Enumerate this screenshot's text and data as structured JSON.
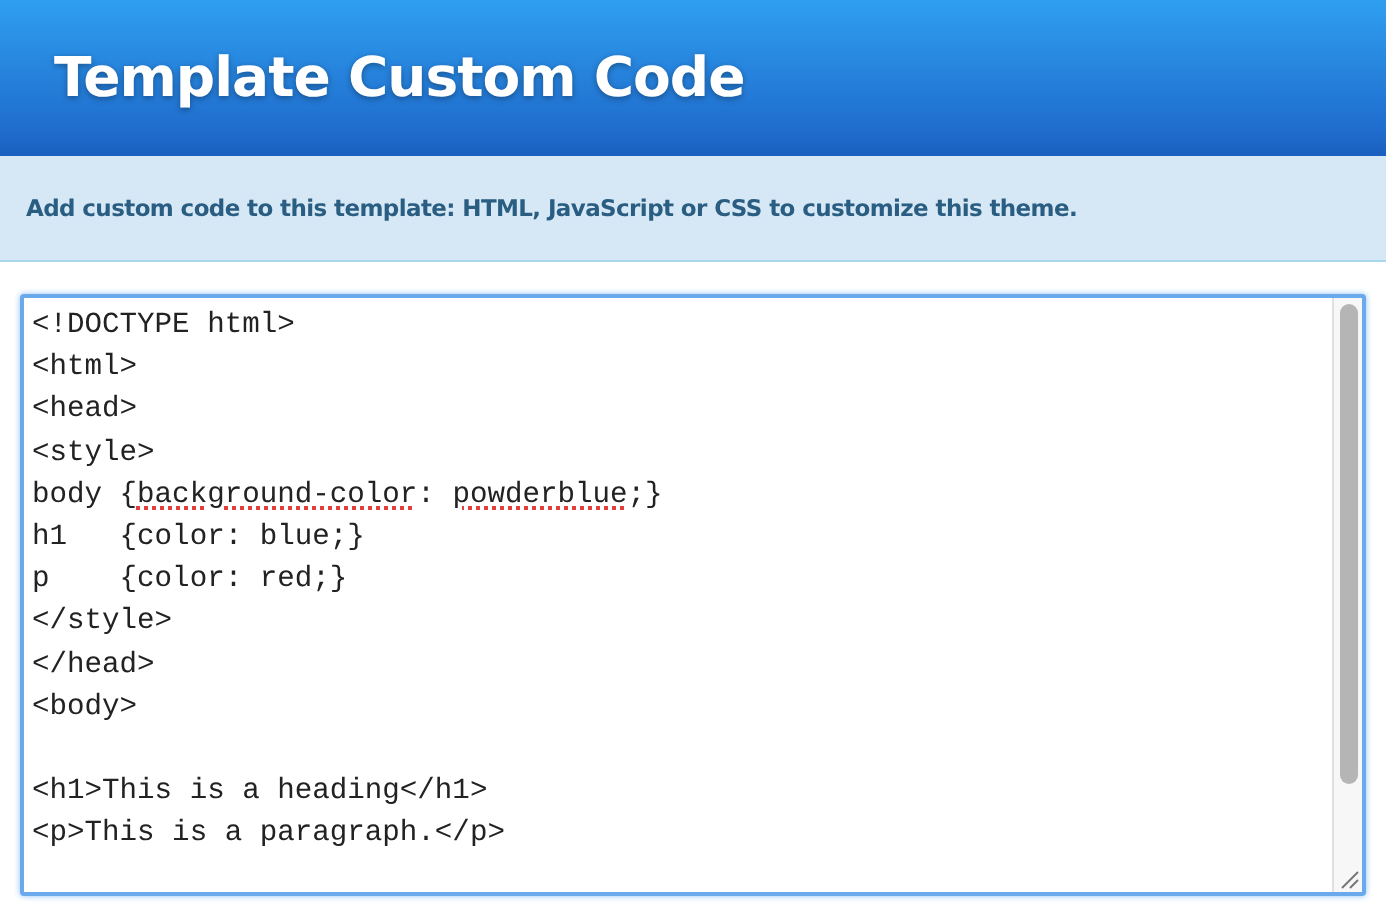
{
  "header": {
    "title": "Template Custom Code"
  },
  "info_bar": {
    "text": "Add custom code to this template: HTML, JavaScript or CSS to customize this theme."
  },
  "editor": {
    "focused": true,
    "lines": [
      {
        "kind": "code",
        "segments": [
          {
            "text": "<!DOCTYPE html>",
            "misspelled": false
          }
        ]
      },
      {
        "kind": "code",
        "segments": [
          {
            "text": "<html>",
            "misspelled": false
          }
        ]
      },
      {
        "kind": "code",
        "segments": [
          {
            "text": "<head>",
            "misspelled": false
          }
        ]
      },
      {
        "kind": "code",
        "segments": [
          {
            "text": "<style>",
            "misspelled": false
          }
        ]
      },
      {
        "kind": "code",
        "segments": [
          {
            "text": "body {",
            "misspelled": false
          },
          {
            "text": "background-color",
            "misspelled": true
          },
          {
            "text": ": ",
            "misspelled": false
          },
          {
            "text": "powderblue",
            "misspelled": true
          },
          {
            "text": ";}",
            "misspelled": false
          }
        ]
      },
      {
        "kind": "code",
        "segments": [
          {
            "text": "h1   {color: blue;}",
            "misspelled": false
          }
        ]
      },
      {
        "kind": "code",
        "segments": [
          {
            "text": "p    {color: red;}",
            "misspelled": false
          }
        ]
      },
      {
        "kind": "code",
        "segments": [
          {
            "text": "</style>",
            "misspelled": false
          }
        ]
      },
      {
        "kind": "code",
        "segments": [
          {
            "text": "</head>",
            "misspelled": false
          }
        ]
      },
      {
        "kind": "code",
        "segments": [
          {
            "text": "<body>",
            "misspelled": false
          }
        ]
      },
      {
        "kind": "blank"
      },
      {
        "kind": "code",
        "segments": [
          {
            "text": "<h1>This is a heading</h1>",
            "misspelled": false
          }
        ]
      },
      {
        "kind": "code",
        "segments": [
          {
            "text": "<p>This is a paragraph.</p>",
            "misspelled": false
          }
        ]
      }
    ]
  }
}
